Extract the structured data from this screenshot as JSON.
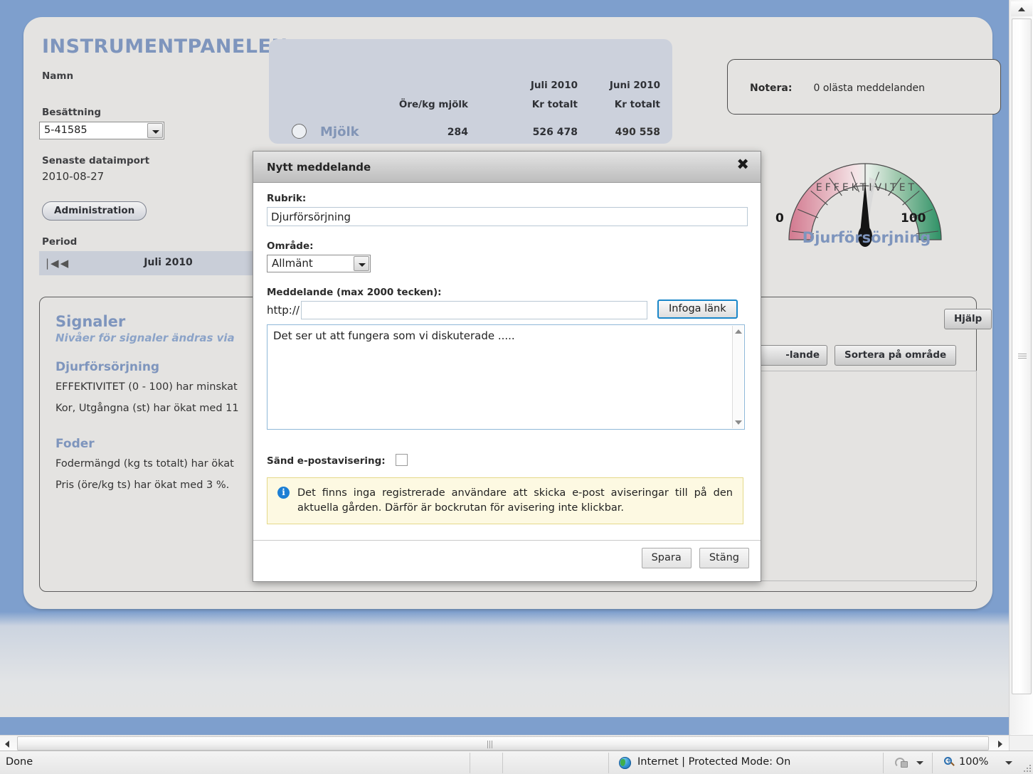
{
  "app": {
    "title": "INSTRUMENTPANELEN"
  },
  "sidebar": {
    "name_label": "Namn",
    "name_value": "",
    "herd_label": "Besättning",
    "herd_value": "5-41585",
    "import_label": "Senaste dataimport",
    "import_value": "2010-08-27",
    "admin_button": "Administration",
    "period_label": "Period",
    "period_value": "Juli 2010",
    "period_nav_first": "|◀",
    "period_nav_prev": "◀"
  },
  "signals": {
    "heading": "Signaler",
    "subheading": "Nivåer för signaler ändras via ",
    "groups": [
      {
        "title": "Djurförsörjning",
        "lines": [
          "EFFEKTIVITET (0 - 100) har minskat",
          "Kor, Utgångna (st) har ökat med 11"
        ]
      },
      {
        "title": "Foder",
        "lines": [
          "Fodermängd (kg ts totalt) har ökat",
          "Pris (öre/kg ts) har ökat med 3 %."
        ]
      }
    ]
  },
  "metrics": {
    "columns": [
      {
        "header_top": "",
        "header_bottom": "Öre/kg mjölk"
      },
      {
        "header_top": "Juli 2010",
        "header_bottom": "Kr totalt"
      },
      {
        "header_top": "Juni 2010",
        "header_bottom": "Kr totalt"
      }
    ],
    "rows": [
      {
        "name": "Mjölk",
        "ore_per_kg": "284",
        "juli_kr_totalt": "526 478",
        "juni_kr_totalt": "490 558"
      }
    ]
  },
  "notera": {
    "key": "Notera:",
    "value": "0 olästa meddelanden"
  },
  "gauge": {
    "caption": "Djurförsörjning",
    "inner_label": "EFFEKTIVITET",
    "min_label": "0",
    "max_label": "100",
    "colors": {
      "low": "#d98fa4",
      "high": "#2e9166"
    }
  },
  "buttons": {
    "help": "Hjälp",
    "new_message_partial": "-lande",
    "sort_by_area": "Sortera på område"
  },
  "modal": {
    "title": "Nytt meddelande",
    "close_icon": "✖",
    "rubrik_label": "Rubrik:",
    "rubrik_value": "Djurförsörjning",
    "omrade_label": "Område:",
    "omrade_value": "Allmänt",
    "meddelande_label": "Meddelande (max 2000 tecken):",
    "link_prefix": "http://",
    "link_value": "",
    "link_placeholder": "",
    "insert_link_button": "Infoga länk",
    "message_text": "Det ser ut att fungera som vi diskuterade .....",
    "email_label": "Sänd e-postavisering:",
    "email_checked": false,
    "info_text": "Det finns inga registrerade användare att skicka e-post aviseringar till på den aktuella gården. Därför är bockrutan för avisering inte klickbar.",
    "save_button": "Spara",
    "close_button": "Stäng"
  },
  "statusbar": {
    "status": "Done",
    "zone": "Internet | Protected Mode: On",
    "zoom": "100%"
  }
}
